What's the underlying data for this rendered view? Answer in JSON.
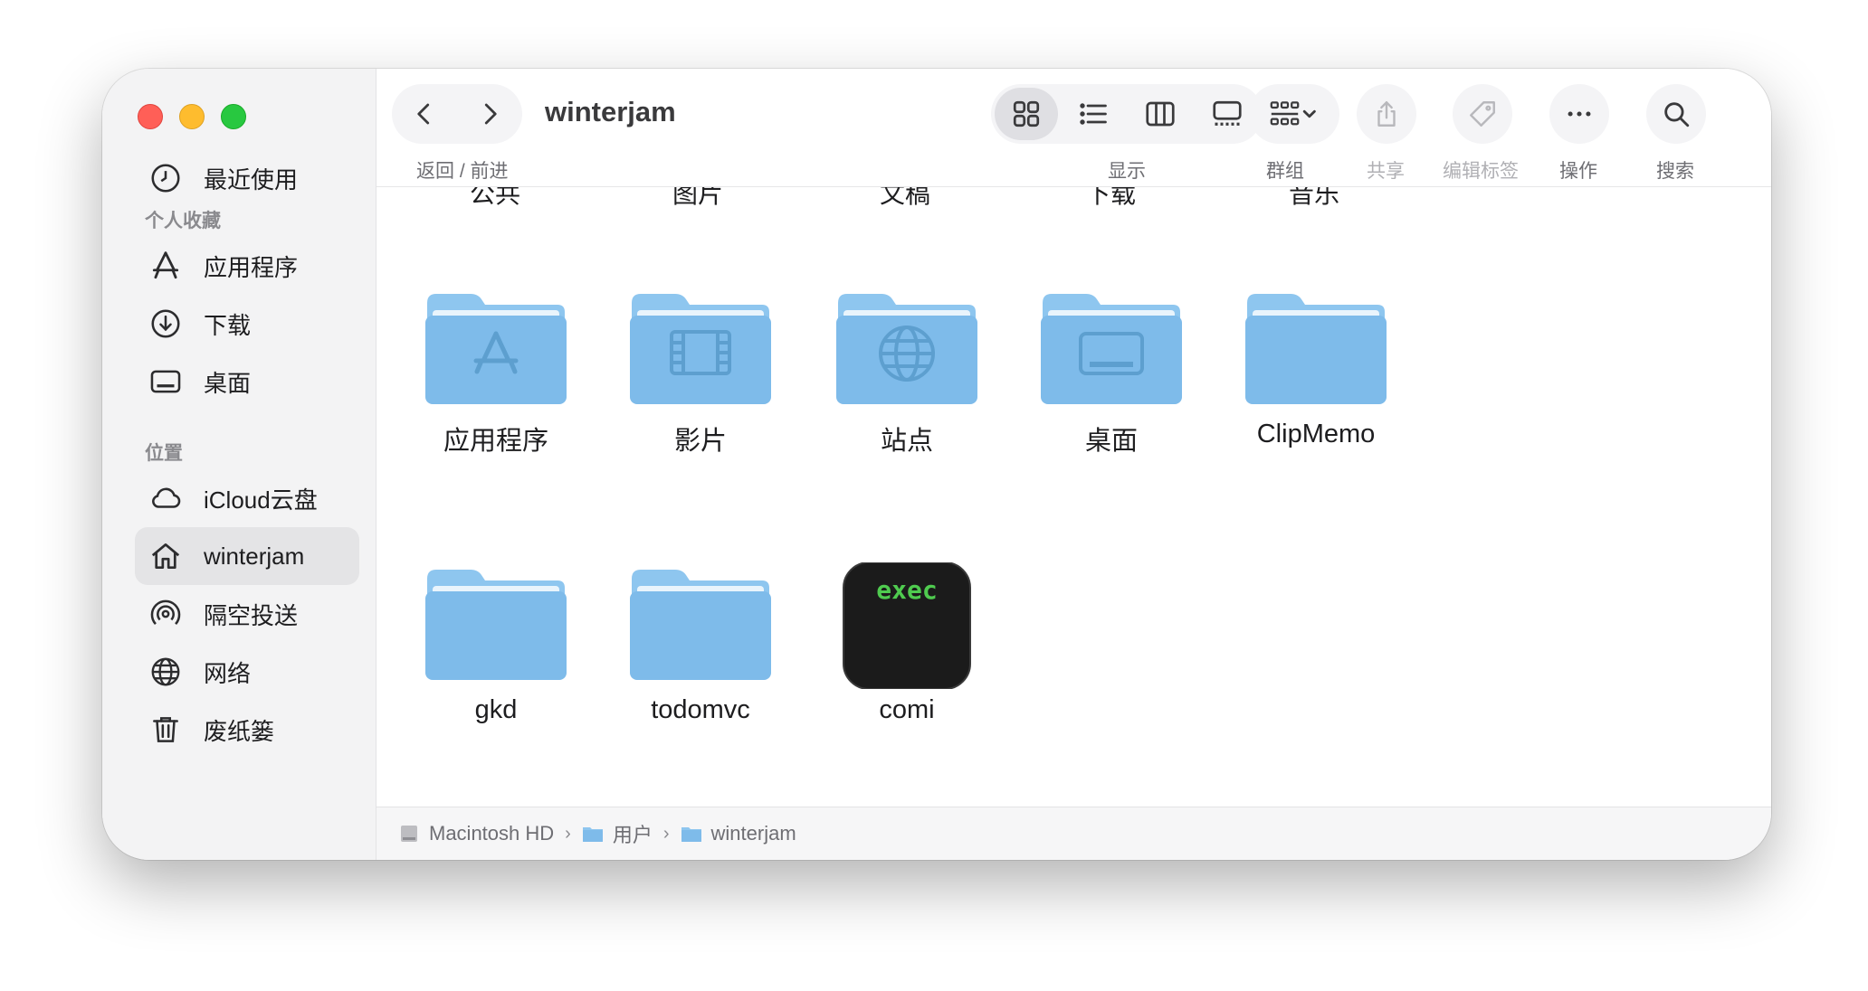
{
  "window": {
    "title": "winterjam"
  },
  "sidebar": {
    "recent_label": "最近使用",
    "favorites_header": "个人收藏",
    "favorites": [
      {
        "label": "应用程序",
        "icon": "app-store-icon"
      },
      {
        "label": "下载",
        "icon": "download-icon"
      },
      {
        "label": "桌面",
        "icon": "desktop-icon"
      }
    ],
    "locations_header": "位置",
    "locations": [
      {
        "label": "iCloud云盘",
        "icon": "cloud-icon"
      },
      {
        "label": "winterjam",
        "icon": "home-icon",
        "selected": true
      },
      {
        "label": "隔空投送",
        "icon": "airdrop-icon"
      },
      {
        "label": "网络",
        "icon": "network-icon"
      },
      {
        "label": "废纸篓",
        "icon": "trash-icon"
      }
    ]
  },
  "toolbar": {
    "nav_label": "返回 / 前进",
    "view_label": "显示",
    "group_label": "群组",
    "share_label": "共享",
    "tags_label": "编辑标签",
    "action_label": "操作",
    "search_label": "搜索"
  },
  "partial_top_row": [
    "公共",
    "图片",
    "文稿",
    "下载",
    "音乐"
  ],
  "files": [
    {
      "name": "应用程序",
      "kind": "folder",
      "glyph": "app-store"
    },
    {
      "name": "影片",
      "kind": "folder",
      "glyph": "film"
    },
    {
      "name": "站点",
      "kind": "folder",
      "glyph": "globe"
    },
    {
      "name": "桌面",
      "kind": "folder",
      "glyph": "desktop"
    },
    {
      "name": "ClipMemo",
      "kind": "folder",
      "glyph": "none"
    },
    {
      "name": "gkd",
      "kind": "folder",
      "glyph": "none"
    },
    {
      "name": "todomvc",
      "kind": "folder",
      "glyph": "none"
    },
    {
      "name": "comi",
      "kind": "executable",
      "glyph_text": "exec"
    }
  ],
  "pathbar": {
    "segments": [
      "Macintosh HD",
      "用户",
      "winterjam"
    ]
  },
  "colors": {
    "folder_back": "#8ec6ef",
    "folder_front": "#7ebbea",
    "folder_tab": "#a9d3f3",
    "exec_bg": "#1b1b1b",
    "exec_text": "#4fcb4f",
    "traffic_red": "#ff5f57",
    "traffic_yellow": "#febc2e",
    "traffic_green": "#28c840"
  }
}
